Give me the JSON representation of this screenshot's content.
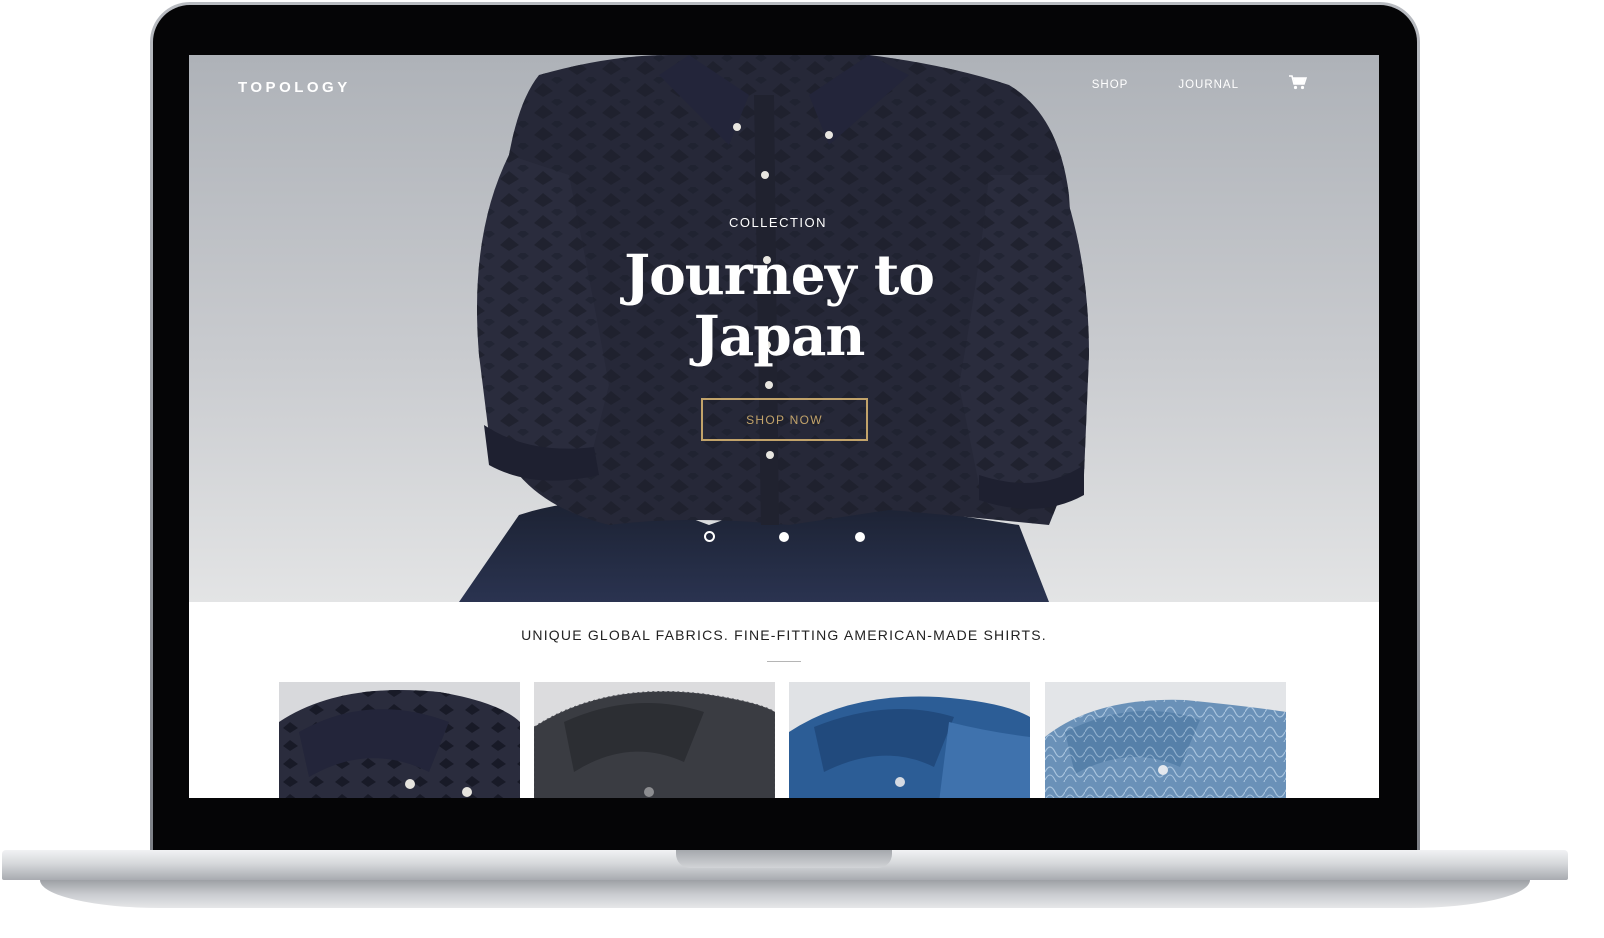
{
  "brand": {
    "logo": "TOPOLOGY"
  },
  "nav": {
    "items": [
      {
        "label": "SHOP"
      },
      {
        "label": "JOURNAL"
      }
    ],
    "cart_icon": "cart-icon"
  },
  "hero": {
    "eyebrow": "COLLECTION",
    "headline": "Journey to Japan",
    "cta_label": "SHOP NOW",
    "slides_total": 3,
    "active_slide": 1
  },
  "tagline": "UNIQUE GLOBAL FABRICS. FINE-FITTING AMERICAN-MADE SHIRTS.",
  "colors": {
    "accent_gold": "#c2a36a",
    "shirt_navy": "#262838",
    "hero_bg_top": "#aeb2b8",
    "hero_bg_bottom": "#e3e4e5"
  },
  "products": [
    {
      "fabric": "navy-pattern-shirt",
      "color": "#2a2c3d"
    },
    {
      "fabric": "charcoal-tweed-shirt",
      "color": "#3a3c42"
    },
    {
      "fabric": "indigo-denim-shirt",
      "color": "#2c5d96"
    },
    {
      "fabric": "blue-print-shirt",
      "color": "#6a91b8"
    }
  ]
}
